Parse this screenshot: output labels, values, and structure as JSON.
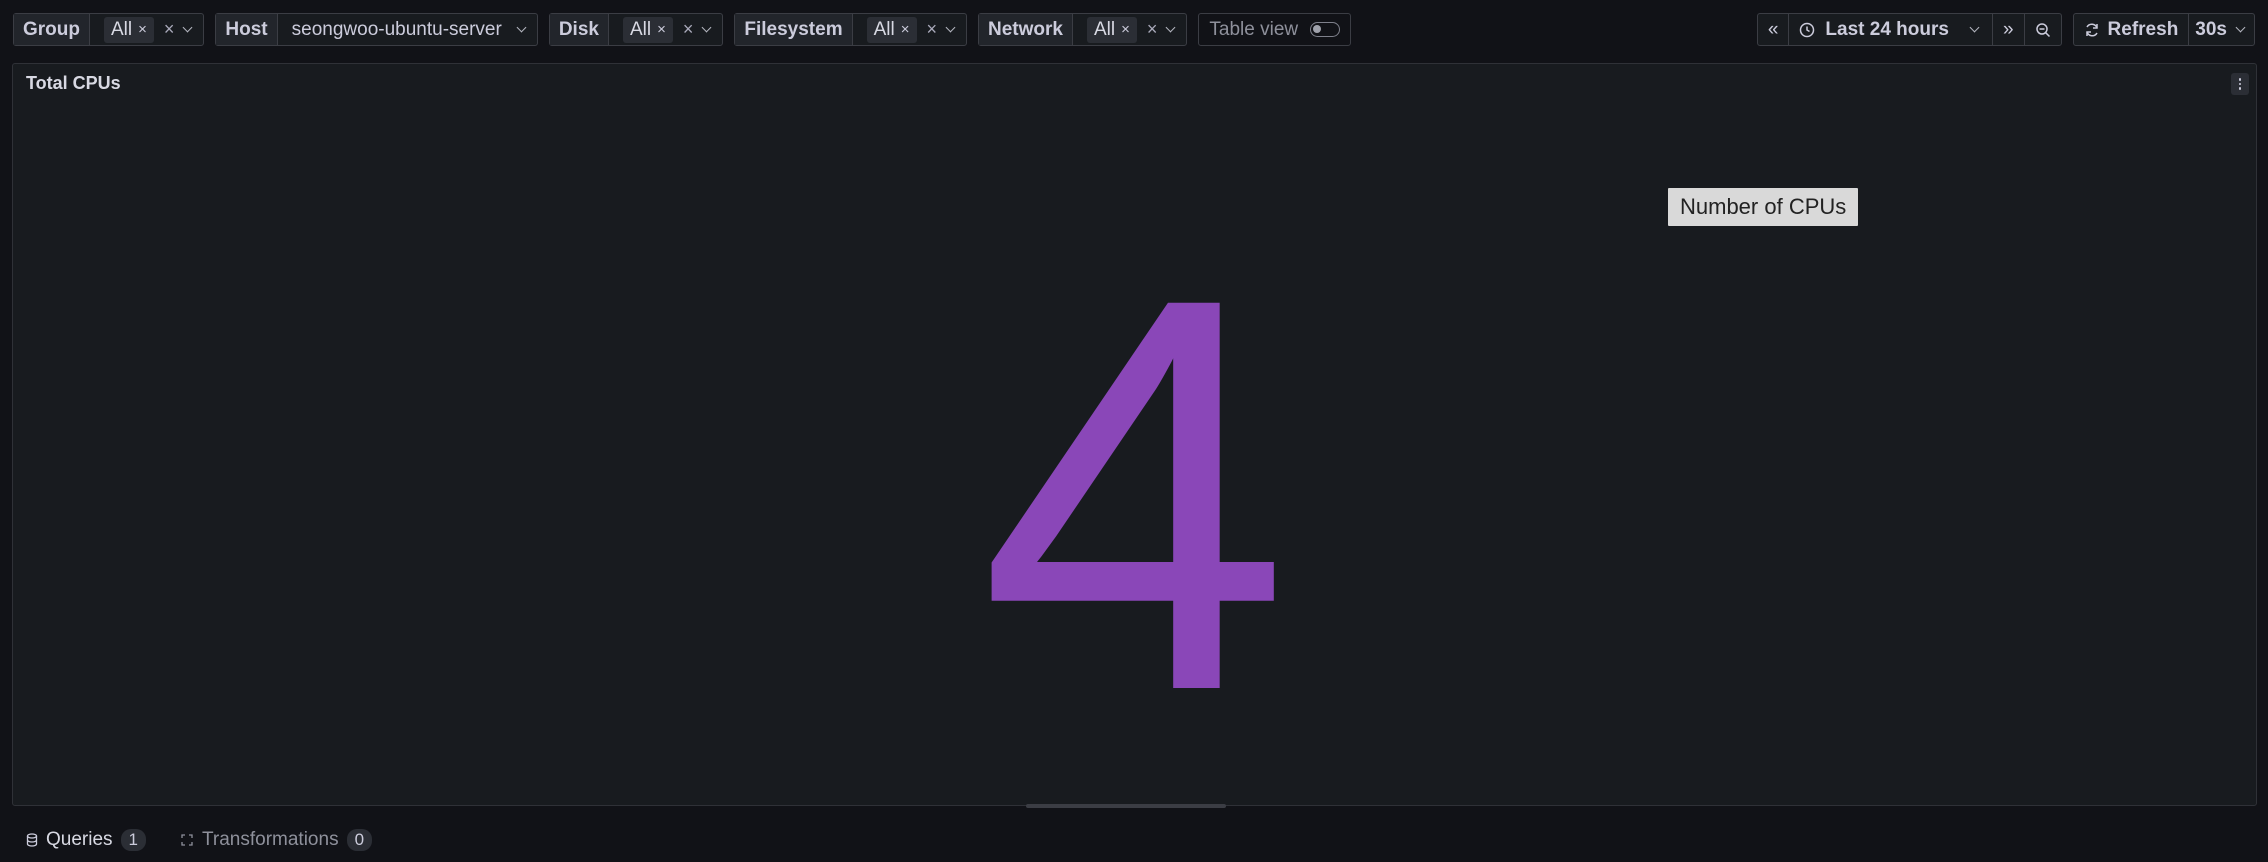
{
  "variables": [
    {
      "label": "Group",
      "chip": "All",
      "chip_x": "×",
      "clear": "×"
    },
    {
      "label": "Host",
      "value": "seongwoo-ubuntu-server"
    },
    {
      "label": "Disk",
      "chip": "All",
      "chip_x": "×",
      "clear": "×"
    },
    {
      "label": "Filesystem",
      "chip": "All",
      "chip_x": "×",
      "clear": "×"
    },
    {
      "label": "Network",
      "chip": "All",
      "chip_x": "×",
      "clear": "×"
    }
  ],
  "table_view": {
    "label": "Table view",
    "enabled": false
  },
  "time": {
    "back_label": "«",
    "range_label": "Last 24 hours",
    "forward_label": "»",
    "zoom_icon": "zoom-out-icon"
  },
  "refresh": {
    "label": "Refresh",
    "interval": "30s"
  },
  "panel": {
    "title": "Total CPUs",
    "value": "4",
    "value_color": "#8a47b8",
    "tooltip": "Number of CPUs"
  },
  "tabs": [
    {
      "label": "Queries",
      "count": "1",
      "icon": "database-icon"
    },
    {
      "label": "Transformations",
      "count": "0",
      "icon": "transform-icon"
    }
  ]
}
